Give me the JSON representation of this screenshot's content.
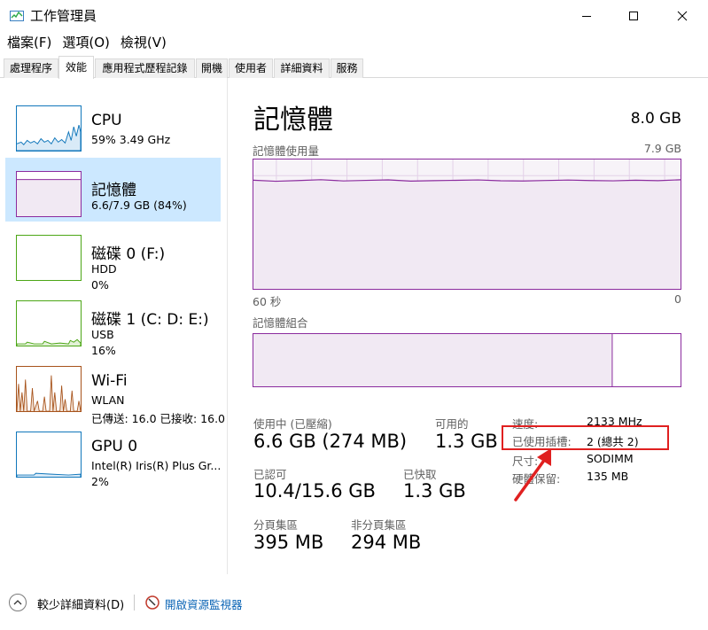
{
  "window": {
    "title": "工作管理員",
    "controls": {
      "minimize": "—",
      "maximize": "☐",
      "close": "✕"
    }
  },
  "menu": [
    {
      "label": "檔案(F)"
    },
    {
      "label": "選項(O)"
    },
    {
      "label": "檢視(V)"
    }
  ],
  "tabs": [
    {
      "label": "處理程序"
    },
    {
      "label": "效能"
    },
    {
      "label": "應用程式歷程記錄"
    },
    {
      "label": "開機"
    },
    {
      "label": "使用者"
    },
    {
      "label": "詳細資料"
    },
    {
      "label": "服務"
    }
  ],
  "sidebar": {
    "items": [
      {
        "title": "CPU",
        "line1": "59%  3.49 GHz",
        "line2": "",
        "color": "#1177bb"
      },
      {
        "title": "記憶體",
        "line1": "6.6/7.9 GB (84%)",
        "line2": "",
        "color": "#8b2b9e"
      },
      {
        "title": "磁碟 0 (F:)",
        "line1": "HDD",
        "line2": "0%",
        "color": "#4ca616"
      },
      {
        "title": "磁碟 1 (C: D: E:)",
        "line1": "USB",
        "line2": "16%",
        "color": "#4ca616"
      },
      {
        "title": "Wi-Fi",
        "line1": "WLAN",
        "line2": "已傳送: 16.0  已接收: 16.0",
        "color": "#a7531b"
      },
      {
        "title": "GPU 0",
        "line1": "Intel(R) Iris(R) Plus Gr...",
        "line2": "2%",
        "color": "#1177bb"
      }
    ]
  },
  "main": {
    "title": "記憶體",
    "total": "8.0 GB",
    "usage_label": "記憶體使用量",
    "usage_max": "7.9 GB",
    "usage_fraction": 0.84,
    "axis_left": "60 秒",
    "axis_right": "0",
    "composition_label": "記憶體組合",
    "composition_used_fraction": 0.84,
    "stats": {
      "in_use_label": "使用中 (已壓縮)",
      "in_use_value": "6.6 GB (274 MB)",
      "available_label": "可用的",
      "available_value": "1.3 GB",
      "committed_label": "已認可",
      "committed_value": "10.4/15.6 GB",
      "cached_label": "已快取",
      "cached_value": "1.3 GB",
      "paged_label": "分頁集區",
      "paged_value": "395 MB",
      "nonpaged_label": "非分頁集區",
      "nonpaged_value": "294 MB"
    },
    "details": {
      "speed_label": "速度:",
      "speed_value": "2133 MHz",
      "slots_label": "已使用插槽:",
      "slots_value": "2 (總共 2)",
      "form_label": "尺寸:",
      "form_value": "SODIMM",
      "reserved_label": "硬體保留:",
      "reserved_value": "135 MB"
    }
  },
  "footer": {
    "fewer_details": "較少詳細資料(D)",
    "open_monitor": "開啟資源監視器"
  },
  "colors": {
    "memory": "#8b2b9e",
    "cpu": "#1177bb",
    "disk": "#4ca616",
    "wifi": "#a7531b",
    "selected_bg": "#cce8ff",
    "annotation": "#e02020"
  }
}
